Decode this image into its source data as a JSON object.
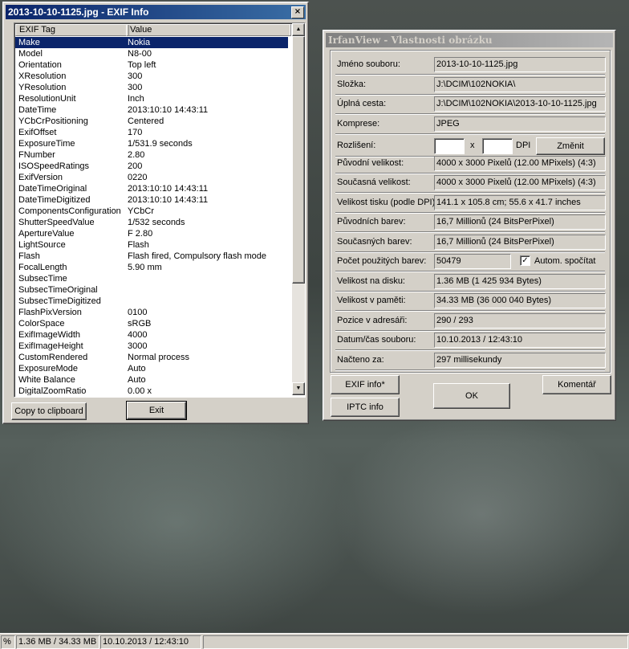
{
  "exif_window": {
    "title": "2013-10-10-1125.jpg - EXIF Info",
    "close_glyph": "×",
    "columns": [
      "EXIF Tag",
      "Value"
    ],
    "rows": [
      [
        "Make",
        "Nokia"
      ],
      [
        "Model",
        "N8-00"
      ],
      [
        "Orientation",
        "Top left"
      ],
      [
        "XResolution",
        "300"
      ],
      [
        "YResolution",
        "300"
      ],
      [
        "ResolutionUnit",
        "Inch"
      ],
      [
        "DateTime",
        "2013:10:10 14:43:11"
      ],
      [
        "YCbCrPositioning",
        "Centered"
      ],
      [
        "ExifOffset",
        "170"
      ],
      [
        "ExposureTime",
        "1/531.9 seconds"
      ],
      [
        "FNumber",
        "2.80"
      ],
      [
        "ISOSpeedRatings",
        "200"
      ],
      [
        "ExifVersion",
        "0220"
      ],
      [
        "DateTimeOriginal",
        "2013:10:10 14:43:11"
      ],
      [
        "DateTimeDigitized",
        "2013:10:10 14:43:11"
      ],
      [
        "ComponentsConfiguration",
        "YCbCr"
      ],
      [
        "ShutterSpeedValue",
        "1/532 seconds"
      ],
      [
        "ApertureValue",
        "F 2.80"
      ],
      [
        "LightSource",
        "Flash"
      ],
      [
        "Flash",
        "Flash fired, Compulsory flash mode"
      ],
      [
        "FocalLength",
        "5.90 mm"
      ],
      [
        "SubsecTime",
        ""
      ],
      [
        "SubsecTimeOriginal",
        ""
      ],
      [
        "SubsecTimeDigitized",
        ""
      ],
      [
        "FlashPixVersion",
        "0100"
      ],
      [
        "ColorSpace",
        "sRGB"
      ],
      [
        "ExifImageWidth",
        "4000"
      ],
      [
        "ExifImageHeight",
        "3000"
      ],
      [
        "CustomRendered",
        "Normal process"
      ],
      [
        "ExposureMode",
        "Auto"
      ],
      [
        "White Balance",
        "Auto"
      ],
      [
        "DigitalZoomRatio",
        "0.00 x"
      ]
    ],
    "copy_label": "Copy to clipboard",
    "exit_label": "Exit",
    "scroll_up": "▲",
    "scroll_down": "▼"
  },
  "props_window": {
    "title": "IrfanView - Vlastnosti obrázku",
    "fields": [
      {
        "label": "Jméno souboru:",
        "value": "2013-10-10-1125.jpg"
      },
      {
        "label": "Složka:",
        "value": "J:\\DCIM\\102NOKIA\\"
      },
      {
        "label": "Úplná cesta:",
        "value": "J:\\DCIM\\102NOKIA\\2013-10-10-1125.jpg"
      },
      {
        "label": "Komprese:",
        "value": "JPEG"
      }
    ],
    "resolution": {
      "label": "Rozlišení:",
      "x": "x",
      "unit": "DPI",
      "button": "Změnit"
    },
    "fields2": [
      {
        "label": "Původní velikost:",
        "value": "4000 x 3000  Pixelů (12.00 MPixels) (4:3)"
      },
      {
        "label": "Současná velikost:",
        "value": "4000 x 3000  Pixelů (12.00 MPixels) (4:3)"
      },
      {
        "label": "Velikost tisku (podle DPI):",
        "value": "141.1 x 105.8 cm; 55.6 x 41.7 inches"
      },
      {
        "label": "Původních barev:",
        "value": "16,7 Millionů  (24 BitsPerPixel)"
      },
      {
        "label": "Současných barev:",
        "value": "16,7 Millionů  (24 BitsPerPixel)"
      }
    ],
    "colors_used": {
      "label": "Počet použitých barev:",
      "value": "50479",
      "checkbox_label": "Autom. spočítat",
      "checked": true
    },
    "fields3": [
      {
        "label": "Velikost na disku:",
        "value": "1.36 MB (1 425 934 Bytes)"
      },
      {
        "label": "Velikost v paměti:",
        "value": "34.33  MB (36 000 040 Bytes)"
      },
      {
        "label": "Pozice v adresáři:",
        "value": "290  /  293"
      },
      {
        "label": "Datum/čas souboru:",
        "value": "10.10.2013 / 12:43:10"
      },
      {
        "label": "Načteno za:",
        "value": "297 millisekundy"
      }
    ],
    "exif_button": "EXIF info*",
    "iptc_button": "IPTC info",
    "ok_button": "OK",
    "comment_button": "Komentář"
  },
  "statusbar": {
    "zoom": "%",
    "size": "1.36 MB / 34.33 MB",
    "date": "10.10.2013 / 12:43:10"
  }
}
